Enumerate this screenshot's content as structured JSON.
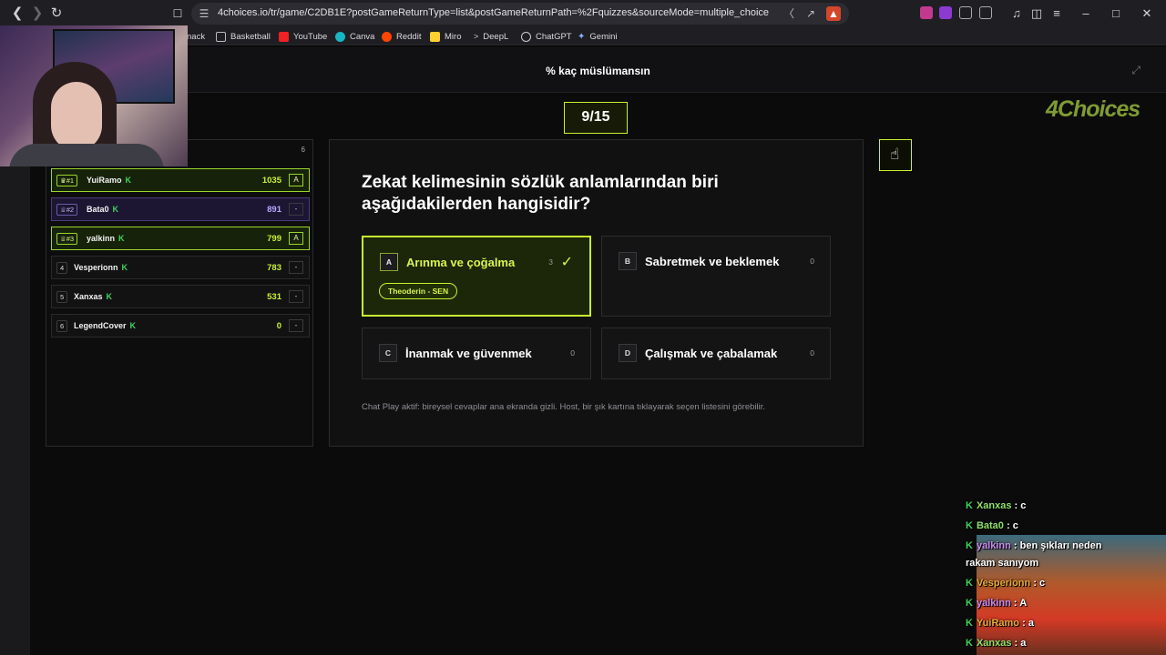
{
  "browser": {
    "url": "4choices.io/tr/game/C2DB1E?postGameReturnType=list&postGameReturnPath=%2Fquizzes&sourceMode=multiple_choice",
    "bookmarks": [
      "nack",
      "Basketball",
      "YouTube",
      "Canva",
      "Reddit",
      "Miro",
      "DeepL",
      "ChatGPT",
      "Gemini"
    ]
  },
  "game": {
    "title": "% kaç müslümansın",
    "progress": "9/15",
    "brand": "4Choices",
    "player_count": "6"
  },
  "leaderboard": [
    {
      "rank": "#1",
      "name": "YuiRamo",
      "score": "1035",
      "answer": "A",
      "style": "gold"
    },
    {
      "rank": "#2",
      "name": "Bata0",
      "score": "891",
      "answer": "-",
      "style": "purple"
    },
    {
      "rank": "#3",
      "name": "yalkinn",
      "score": "799",
      "answer": "A",
      "style": "gold"
    },
    {
      "rank": "4",
      "name": "Vesperionn",
      "score": "783",
      "answer": "-",
      "style": "plain"
    },
    {
      "rank": "5",
      "name": "Xanxas",
      "score": "531",
      "answer": "-",
      "style": "plain"
    },
    {
      "rank": "6",
      "name": "LegendCover",
      "score": "0",
      "answer": "-",
      "style": "plain"
    }
  ],
  "question": {
    "text": "Zekat kelimesinin sözlük anlamlarından biri aşağıdakilerden hangisidir?",
    "options": [
      {
        "letter": "A",
        "text": "Arınma ve çoğalma",
        "count": "3",
        "correct": true,
        "chooser": "Theoderin - SEN"
      },
      {
        "letter": "B",
        "text": "Sabretmek ve beklemek",
        "count": "0"
      },
      {
        "letter": "C",
        "text": "İnanmak ve güvenmek",
        "count": "0"
      },
      {
        "letter": "D",
        "text": "Çalışmak ve çabalamak",
        "count": "0"
      }
    ],
    "note": "Chat Play aktif: bireysel cevaplar ana ekranda gizli. Host, bir şık kartına tıklayarak seçen listesini görebilir."
  },
  "kick_badge": "K",
  "chat": [
    {
      "user": "Xanxas",
      "msg": ": c"
    },
    {
      "user": "Bata0",
      "msg": ": c"
    },
    {
      "user": "yalkinn",
      "msg": ": ben şıkları neden"
    },
    {
      "user": "",
      "msg": "rakam sanıyom"
    },
    {
      "user": "Vesperionn",
      "msg": ": c"
    },
    {
      "user": "yalkinn",
      "msg": ": A"
    },
    {
      "user": "YuiRamo",
      "msg": ": a"
    },
    {
      "user": "Xanxas",
      "msg": ": a"
    }
  ]
}
